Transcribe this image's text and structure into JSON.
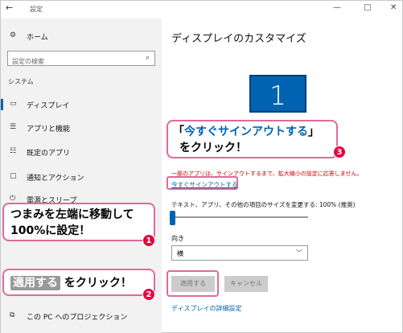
{
  "window": {
    "title": "設定",
    "back_glyph": "←",
    "minimize_glyph": "—",
    "maximize_glyph": "□",
    "close_glyph": "✕"
  },
  "sidebar": {
    "home_label": "ホーム",
    "search_placeholder": "設定の検索",
    "section_label": "システム",
    "items": [
      {
        "label": "ディスプレイ",
        "icon": "display-icon",
        "glyph": "▭",
        "selected": true
      },
      {
        "label": "アプリと機能",
        "icon": "apps-list-icon",
        "glyph": "☰"
      },
      {
        "label": "既定のアプリ",
        "icon": "default-apps-icon",
        "glyph": "☷"
      },
      {
        "label": "通知とアクション",
        "icon": "notifications-icon",
        "glyph": "▢"
      },
      {
        "label": "電源とスリープ",
        "icon": "power-icon",
        "glyph": "⏻"
      },
      {
        "label": "この PC へのプロジェクション",
        "icon": "projection-icon",
        "glyph": "⧉"
      }
    ]
  },
  "main": {
    "title": "ディスプレイのカスタマイズ",
    "monitor_number": "1",
    "warning_text": "一部のアプリは、サインアウトするまで、拡大縮小の設定に応答しません。",
    "signout_link": "今すぐサインアウトする",
    "scale_label": "テキスト、アプリ、その他の項目のサイズを変更する: 100% (推奨)",
    "scale_percent": 100,
    "orientation_label": "向き",
    "orientation_value": "横",
    "apply_button": "適用する",
    "cancel_button": "キャンセル",
    "detail_link": "ディスプレイの詳細設定"
  },
  "callouts": {
    "signout": {
      "open_bracket": "「",
      "highlight": "今すぐサインアウトする",
      "close_bracket": "」",
      "line2": "をクリック！",
      "step": "3"
    },
    "slider": {
      "line1": "つまみを左端に移動して",
      "line2": "100%に設定！",
      "step": "1"
    },
    "apply": {
      "chip": "適用する",
      "text": "をクリック！",
      "step": "2"
    }
  },
  "colors": {
    "accent": "#0063b1",
    "callout_border": "#e06a9a",
    "badge": "#e8003d",
    "warning": "#d00000"
  }
}
